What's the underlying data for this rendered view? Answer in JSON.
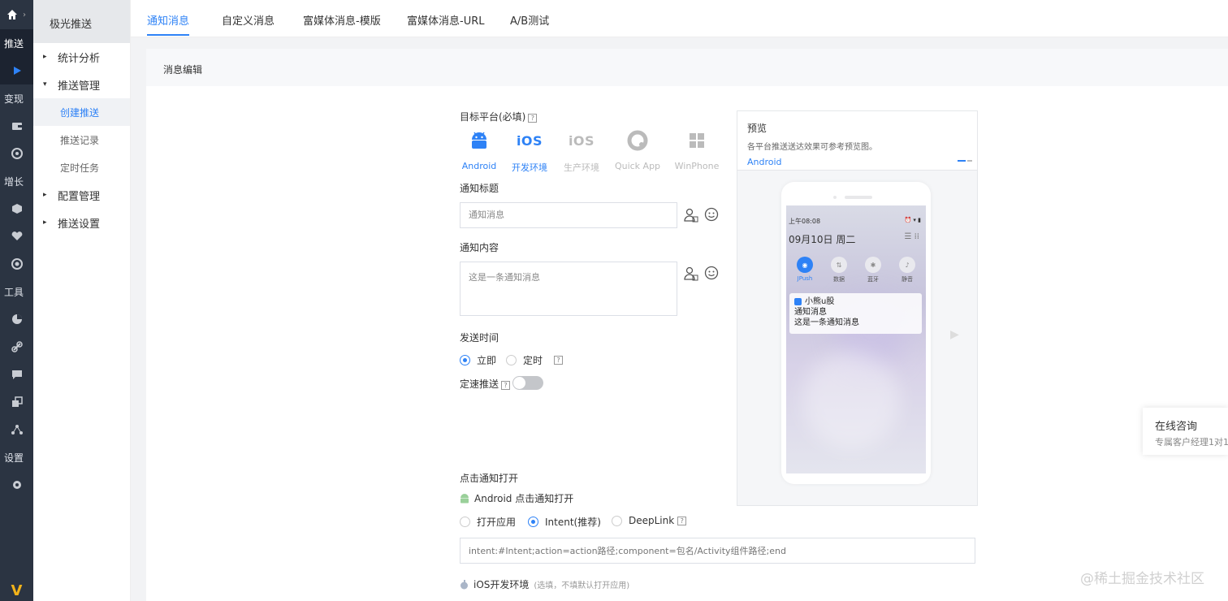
{
  "rail": {
    "sections": [
      "推送",
      "变现",
      "增长",
      "工具",
      "设置"
    ]
  },
  "sidebar": {
    "title": "极光推送",
    "groups": [
      {
        "label": "统计分析"
      },
      {
        "label": "推送管理",
        "items": [
          "创建推送",
          "推送记录",
          "定时任务"
        ]
      },
      {
        "label": "配置管理"
      },
      {
        "label": "推送设置"
      }
    ],
    "active_item": "创建推送"
  },
  "tabs": [
    "通知消息",
    "自定义消息",
    "富媒体消息-模版",
    "富媒体消息-URL",
    "A/B测试"
  ],
  "active_tab": "通知消息",
  "panel": {
    "title": "消息编辑"
  },
  "form": {
    "platform_label": "目标平台(必填)",
    "platforms": [
      {
        "name": "Android",
        "selected": true,
        "icon": "android-icon"
      },
      {
        "name": "开发环境",
        "selected": true,
        "icon": "ios-icon"
      },
      {
        "name": "生产环境",
        "selected": false,
        "icon": "ios-icon"
      },
      {
        "name": "Quick App",
        "selected": false,
        "icon": "quickapp-icon"
      },
      {
        "name": "WinPhone",
        "selected": false,
        "icon": "windows-icon"
      }
    ],
    "ios_logo_text": "iOS",
    "title_label": "通知标题",
    "title_value": "通知消息",
    "content_label": "通知内容",
    "content_value": "这是一条通知消息",
    "send_time_label": "发送时间",
    "send_time_options": [
      "立即",
      "定时"
    ],
    "send_time_selected": "立即",
    "speed_label": "定速推送",
    "speed_enabled": false,
    "click_label": "点击通知打开",
    "android_click_label": "Android 点击通知打开",
    "android_click_options": [
      "打开应用",
      "Intent(推荐)",
      "DeepLink"
    ],
    "android_click_selected": "Intent(推荐)",
    "intent_placeholder": "intent:#Intent;action=action路径;component=包名/Activity组件路径;end",
    "ios_dev_label": "iOS开发环境",
    "ios_dev_hint": "(选填，不填默认打开应用)"
  },
  "preview": {
    "title": "预览",
    "subtitle": "各平台推送送达效果可参考预览图。",
    "platform": "Android",
    "status_time": "上午08:08",
    "date": "09月10日  周二",
    "quick_settings": [
      "JPush",
      "数据",
      "蓝牙",
      "静音"
    ],
    "notif_app": "小熊u股",
    "notif_title": "通知消息",
    "notif_body": "这是一条通知消息"
  },
  "consult": {
    "title": "在线咨询",
    "subtitle": "专属客户经理1对1"
  },
  "watermark": "@稀土掘金技术社区",
  "colors": {
    "accent": "#2e82f6",
    "rail_bg": "#2b3442",
    "logo": "#f1b21a"
  }
}
